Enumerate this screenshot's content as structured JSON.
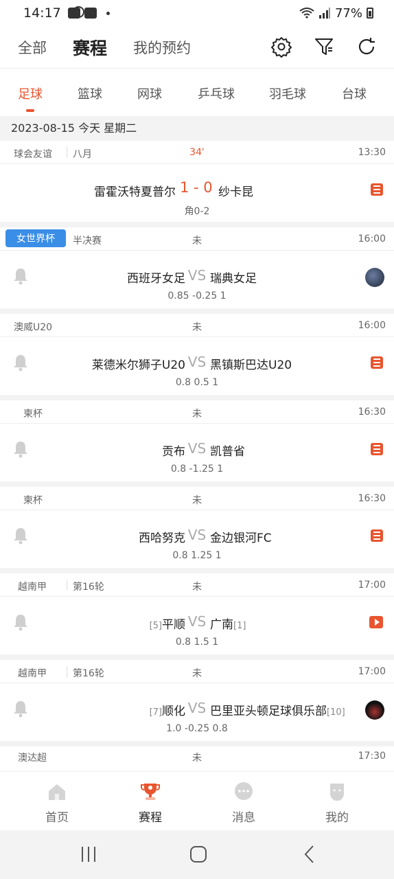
{
  "status_bar": {
    "time": "14:17",
    "battery": "77%"
  },
  "top_nav": {
    "tabs": [
      "全部",
      "赛程",
      "我的预约"
    ],
    "active_index": 1
  },
  "sport_tabs": [
    "足球",
    "篮球",
    "网球",
    "乒乓球",
    "羽毛球",
    "台球"
  ],
  "date_header": "2023-08-15  今天  星期二",
  "matches": [
    {
      "league": "球会友谊",
      "round": "八月",
      "state": "34'",
      "time": "13:30",
      "home": "雷霍沃特夏普尔",
      "away": "纱卡昆",
      "score": "1 - 0",
      "sub": "角0-2",
      "right_icon": "news-icon"
    },
    {
      "league": "女世界杯",
      "round": "半决赛",
      "state": "未",
      "time": "16:00",
      "home": "西班牙女足",
      "away": "瑞典女足",
      "vs": "VS",
      "sub": "0.85  -0.25  1",
      "right_icon": "avatar"
    },
    {
      "league": "澳威U20",
      "round": "",
      "state": "未",
      "time": "16:00",
      "home": "莱德米尔狮子U20",
      "away": "黑镇斯巴达U20",
      "vs": "VS",
      "sub": "0.8  0.5  1",
      "right_icon": "news-icon"
    },
    {
      "league": "柬杯",
      "round": "",
      "state": "未",
      "time": "16:30",
      "home": "贡布",
      "away": "凯普省",
      "vs": "VS",
      "sub": "0.8  -1.25  1",
      "right_icon": "news-icon"
    },
    {
      "league": "柬杯",
      "round": "",
      "state": "未",
      "time": "16:30",
      "home": "西哈努克",
      "away": "金边银河FC",
      "vs": "VS",
      "sub": "0.8  1.25  1",
      "right_icon": "news-icon"
    },
    {
      "league": "越南甲",
      "round": "第16轮",
      "state": "未",
      "time": "17:00",
      "home": "平顺",
      "home_rank": "[5]",
      "away": "广南",
      "away_rank": "[1]",
      "vs": "VS",
      "sub": "0.8  1.5  1",
      "right_icon": "video-icon"
    },
    {
      "league": "越南甲",
      "round": "第16轮",
      "state": "未",
      "time": "17:00",
      "home": "顺化",
      "home_rank": "[7]",
      "away": "巴里亚头顿足球俱乐部",
      "away_rank": "[10]",
      "vs": "VS",
      "sub": "1.0  -0.25  0.8",
      "right_icon": "avatar-dark"
    }
  ],
  "last_row": {
    "league": "澳达超",
    "state": "未",
    "time": "17:30"
  },
  "bottom_nav": [
    "首页",
    "赛程",
    "消息",
    "我的"
  ],
  "colors": {
    "accent": "#e8552f",
    "tag_blue": "#3a8ee6"
  }
}
